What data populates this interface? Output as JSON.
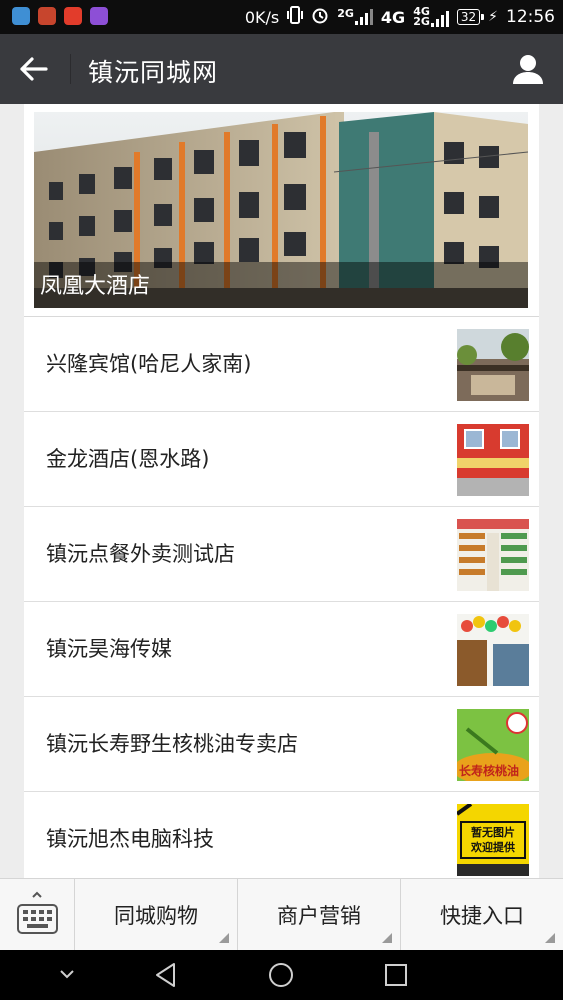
{
  "status_bar": {
    "net_speed": "0K/s",
    "sig2g_tag": "2G",
    "net_4g": "4G",
    "sig4g_tag_a": "4G",
    "sig4g_tag_b": "2G",
    "battery": "32",
    "time": "12:56"
  },
  "nav": {
    "title": "镇沅同城网"
  },
  "hero": {
    "caption": "凤凰大酒店"
  },
  "items": [
    {
      "name": "兴隆宾馆(哈尼人家南)"
    },
    {
      "name": "金龙酒店(恩水路)"
    },
    {
      "name": "镇沅点餐外卖测试店"
    },
    {
      "name": "镇沅昊海传媒"
    },
    {
      "name": "镇沅长寿野生核桃油专卖店"
    },
    {
      "name": "镇沅旭杰电脑科技"
    }
  ],
  "thumb_text": {
    "oil_banner": "长寿核桃油",
    "placeholder_line1": "暂无图片",
    "placeholder_line2": "欢迎提供"
  },
  "menu": {
    "shopping": "同城购物",
    "marketing": "商户营销",
    "quick_entry": "快捷入口"
  },
  "colors": {
    "nav_bg": "#393a3e",
    "menu_bg": "#f7f7f7"
  }
}
